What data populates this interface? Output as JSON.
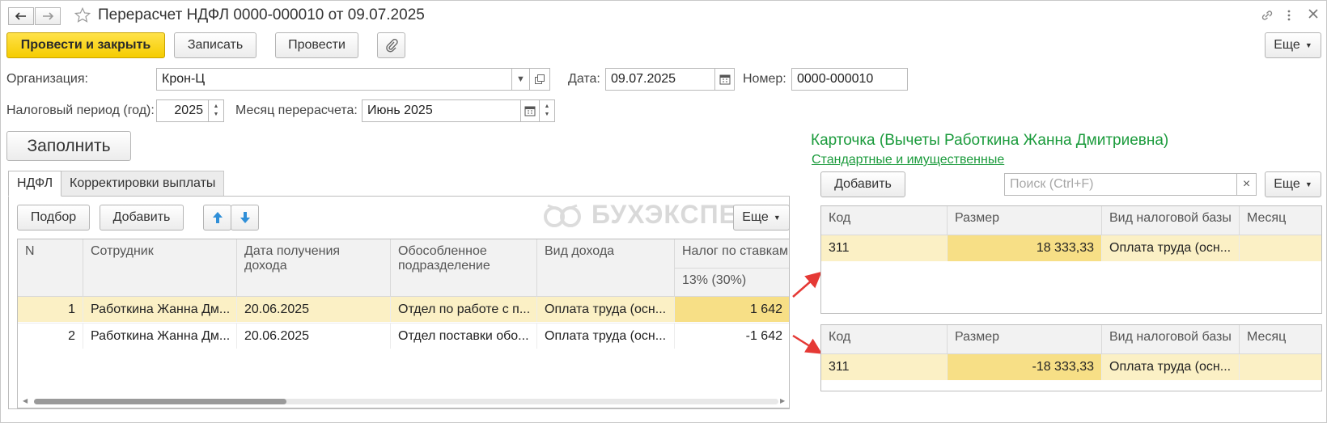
{
  "window": {
    "title": "Перерасчет НДФЛ 0000-000010 от 09.07.2025"
  },
  "toolbar": {
    "post_close": "Провести и закрыть",
    "save": "Записать",
    "post": "Провести",
    "more": "Еще"
  },
  "form": {
    "org_label": "Организация:",
    "org_value": "Крон-Ц",
    "date_label": "Дата:",
    "date_value": "09.07.2025",
    "number_label": "Номер:",
    "number_value": "0000-000010",
    "period_label": "Налоговый период (год):",
    "period_value": "2025",
    "month_label": "Месяц перерасчета:",
    "month_value": "Июнь 2025",
    "fill_button": "Заполнить"
  },
  "tabs": [
    {
      "label": "НДФЛ",
      "active": true
    },
    {
      "label": "Корректировки выплаты",
      "active": false
    }
  ],
  "left_toolbar": {
    "pick": "Подбор",
    "add": "Добавить",
    "more": "Еще"
  },
  "watermark": "БУХЭКСПЕРТ",
  "left_table": {
    "headers": {
      "n": "N",
      "employee": "Сотрудник",
      "income_date": "Дата получения дохода",
      "division": "Обособленное подразделение",
      "income_type": "Вид дохода",
      "tax": "Налог по ставкам",
      "tax_sub": "13% (30%)"
    },
    "rows": [
      {
        "n": "1",
        "employee": "Работкина Жанна Дм...",
        "income_date": "20.06.2025",
        "division": "Отдел по работе с п...",
        "income_type": "Оплата труда (осн...",
        "tax": "1 642",
        "selected": true
      },
      {
        "n": "2",
        "employee": "Работкина Жанна Дм...",
        "income_date": "20.06.2025",
        "division": "Отдел поставки обо...",
        "income_type": "Оплата труда (осн...",
        "tax": "-1 642",
        "selected": false
      }
    ]
  },
  "card": {
    "title": "Карточка (Вычеты Работкина Жанна Дмитриевна)",
    "link": "Стандартные и имущественные",
    "add": "Добавить",
    "search_placeholder": "Поиск (Ctrl+F)",
    "more": "Еще",
    "headers": {
      "code": "Код",
      "size": "Размер",
      "base": "Вид налоговой базы",
      "month": "Месяц"
    },
    "table1": [
      {
        "code": "311",
        "size": "18 333,33",
        "base": "Оплата труда (осн..."
      }
    ],
    "table2": [
      {
        "code": "311",
        "size": "-18 333,33",
        "base": "Оплата труда (осн..."
      }
    ]
  },
  "colors": {
    "accent_yellow": "#f5cc00",
    "selected_row": "#fbf0c5",
    "green_title": "#1b9b3c",
    "arrow_red": "#e53935",
    "blue_arrow": "#2f8fd8"
  }
}
